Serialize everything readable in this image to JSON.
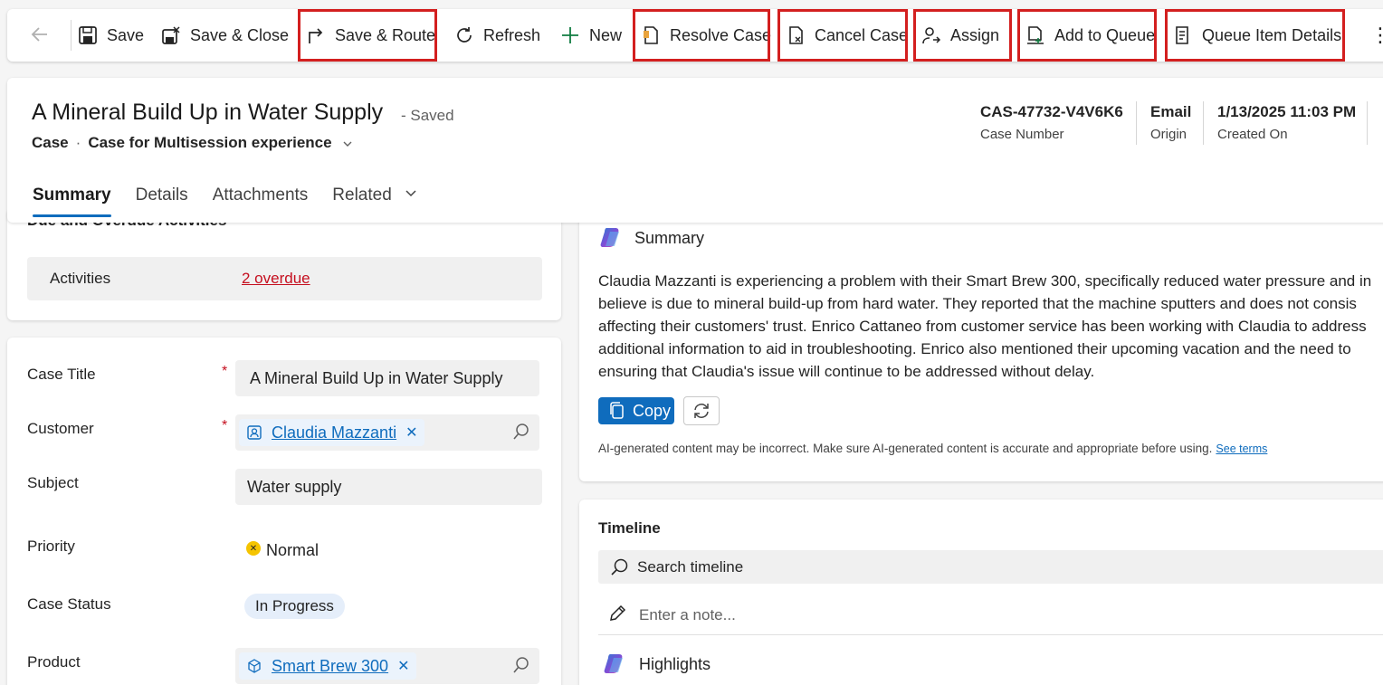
{
  "commandbar": {
    "save": "Save",
    "save_close": "Save & Close",
    "save_route": "Save & Route",
    "refresh": "Refresh",
    "new": "New",
    "resolve": "Resolve Case",
    "cancel": "Cancel Case",
    "assign": "Assign",
    "add_queue": "Add to Queue",
    "queue_details": "Queue Item Details"
  },
  "header": {
    "title": "A Mineral Build Up in Water Supply",
    "saved": "- Saved",
    "entity": "Case",
    "separator": "·",
    "form": "Case for Multisession experience",
    "fields": [
      {
        "value": "CAS-47732-V4V6K6",
        "label": "Case Number"
      },
      {
        "value": "Email",
        "label": "Origin"
      },
      {
        "value": "1/13/2025 11:03 PM",
        "label": "Created On"
      }
    ],
    "tabs": [
      "Summary",
      "Details",
      "Attachments",
      "Related"
    ]
  },
  "activities": {
    "section_title": "Due and Overdue Activities",
    "label": "Activities",
    "value": "2 overdue"
  },
  "form": {
    "case_title_label": "Case Title",
    "case_title_value": "A Mineral Build Up in Water Supply",
    "customer_label": "Customer",
    "customer_value": "Claudia Mazzanti",
    "subject_label": "Subject",
    "subject_value": "Water supply",
    "priority_label": "Priority",
    "priority_value": "Normal",
    "status_label": "Case Status",
    "status_value": "In Progress",
    "product_label": "Product",
    "product_value": "Smart Brew 300",
    "required_marker": "*"
  },
  "summary": {
    "heading": "Summary",
    "lines": [
      "Claudia Mazzanti is experiencing a problem with their Smart Brew 300, specifically reduced water pressure and in",
      "believe is due to mineral build-up from hard water. They reported that the machine sputters and does not consis",
      "affecting their customers' trust. Enrico Cattaneo from customer service has been working with Claudia to address",
      "additional information to aid in troubleshooting. Enrico also mentioned their upcoming vacation and the need to",
      "ensuring that Claudia's issue will continue to be addressed without delay."
    ],
    "copy_label": "Copy",
    "disclaimer": "AI-generated content may be incorrect. Make sure AI-generated content is accurate and appropriate before using.",
    "terms": "See terms"
  },
  "timeline": {
    "heading": "Timeline",
    "search_placeholder": "Search timeline",
    "note_placeholder": "Enter a note...",
    "highlights": "Highlights"
  },
  "colors": {
    "accent": "#0f6cbd",
    "highlight_box": "#d31f1f",
    "overdue": "#c50f1f"
  }
}
